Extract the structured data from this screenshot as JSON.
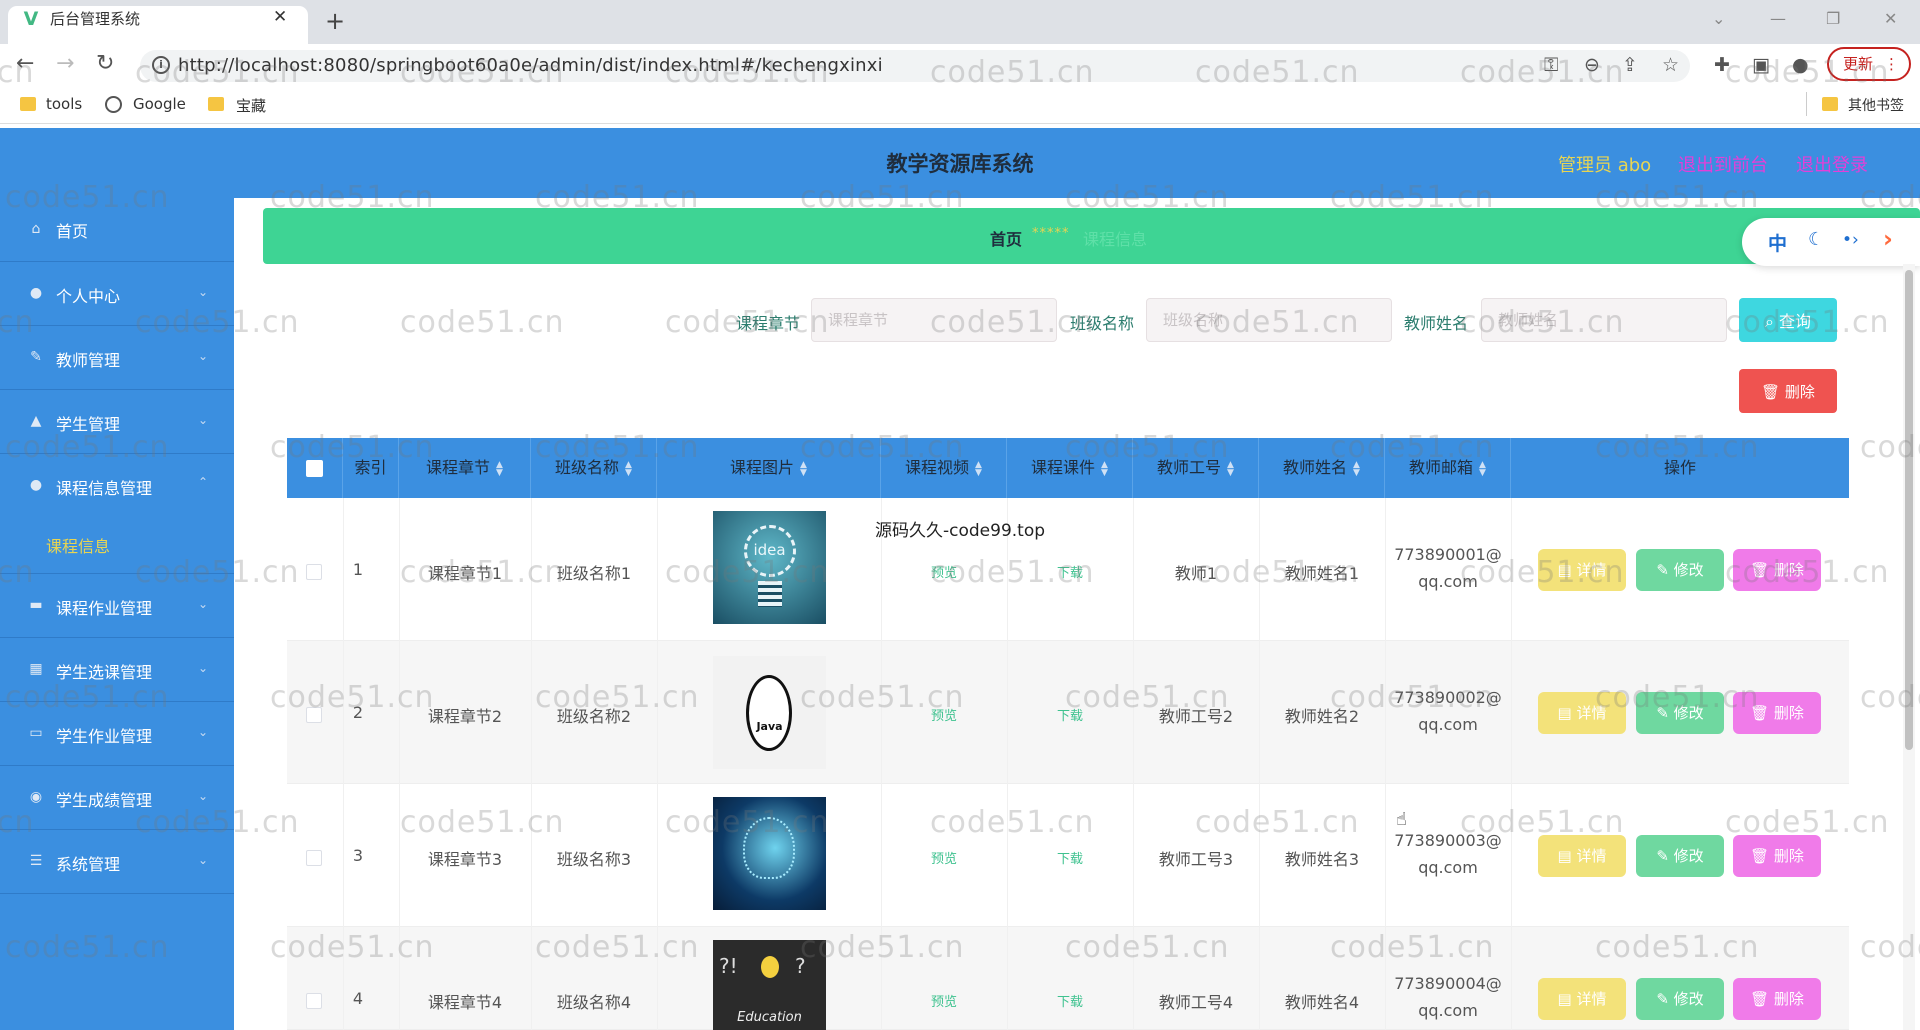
{
  "browser": {
    "tab_title": "后台管理系统",
    "url": "http://localhost:8080/springboot60a0e/admin/dist/index.html#/kechengxinxi",
    "update_label": "更新",
    "bookmarks": [
      "tools",
      "Google",
      "宝藏"
    ],
    "other_bookmarks": "其他书签"
  },
  "header": {
    "title": "教学资源库系统",
    "user": "管理员 abo",
    "exit_front": "退出到前台",
    "logout": "退出登录"
  },
  "sidebar": {
    "items": [
      {
        "label": "首页",
        "icon": "home-icon"
      },
      {
        "label": "个人中心",
        "icon": "user-icon"
      },
      {
        "label": "教师管理",
        "icon": "edit-icon"
      },
      {
        "label": "学生管理",
        "icon": "student-icon"
      },
      {
        "label": "课程信息管理",
        "icon": "user-icon"
      },
      {
        "label": "课程作业管理",
        "icon": "folder-icon"
      },
      {
        "label": "学生选课管理",
        "icon": "calendar-icon"
      },
      {
        "label": "学生作业管理",
        "icon": "screen-icon"
      },
      {
        "label": "学生成绩管理",
        "icon": "pin-icon"
      },
      {
        "label": "系统管理",
        "icon": "menu-icon"
      }
    ],
    "sub_item": "课程信息"
  },
  "breadcrumb": {
    "home": "首页",
    "sep": "*****",
    "current": "课程信息"
  },
  "lang": {
    "zh": "中"
  },
  "search": {
    "fields": [
      {
        "label": "课程章节",
        "placeholder": "课程章节"
      },
      {
        "label": "班级名称",
        "placeholder": "班级名称"
      },
      {
        "label": "教师姓名",
        "placeholder": "教师姓名"
      }
    ],
    "query_label": "查询",
    "delete_label": "删除"
  },
  "table": {
    "headers": [
      "索引",
      "课程章节",
      "班级名称",
      "课程图片",
      "课程视频",
      "课程课件",
      "教师工号",
      "教师姓名",
      "教师邮箱",
      "操作"
    ],
    "preview_label": "预览",
    "download_label": "下载",
    "detail_label": "详情",
    "edit_label": "修改",
    "delete_label": "删除",
    "rows": [
      {
        "index": "1",
        "chapter": "课程章节1",
        "class": "班级名称1",
        "tno": "教师1",
        "tname": "教师姓名1",
        "email1": "773890001@",
        "email2": "qq.com"
      },
      {
        "index": "2",
        "chapter": "课程章节2",
        "class": "班级名称2",
        "tno": "教师工号2",
        "tname": "教师姓名2",
        "email1": "773890002@",
        "email2": "qq.com"
      },
      {
        "index": "3",
        "chapter": "课程章节3",
        "class": "班级名称3",
        "tno": "教师工号3",
        "tname": "教师姓名3",
        "email1": "773890003@",
        "email2": "qq.com"
      },
      {
        "index": "4",
        "chapter": "课程章节4",
        "class": "班级名称4",
        "tno": "教师工号4",
        "tname": "教师姓名4",
        "email1": "773890004@",
        "email2": "qq.com"
      }
    ]
  },
  "overlay_text": "源码久久-code99.top",
  "image_texts": {
    "idea": "idea",
    "java": "Java",
    "education": "Education"
  },
  "watermark": "code51.cn"
}
